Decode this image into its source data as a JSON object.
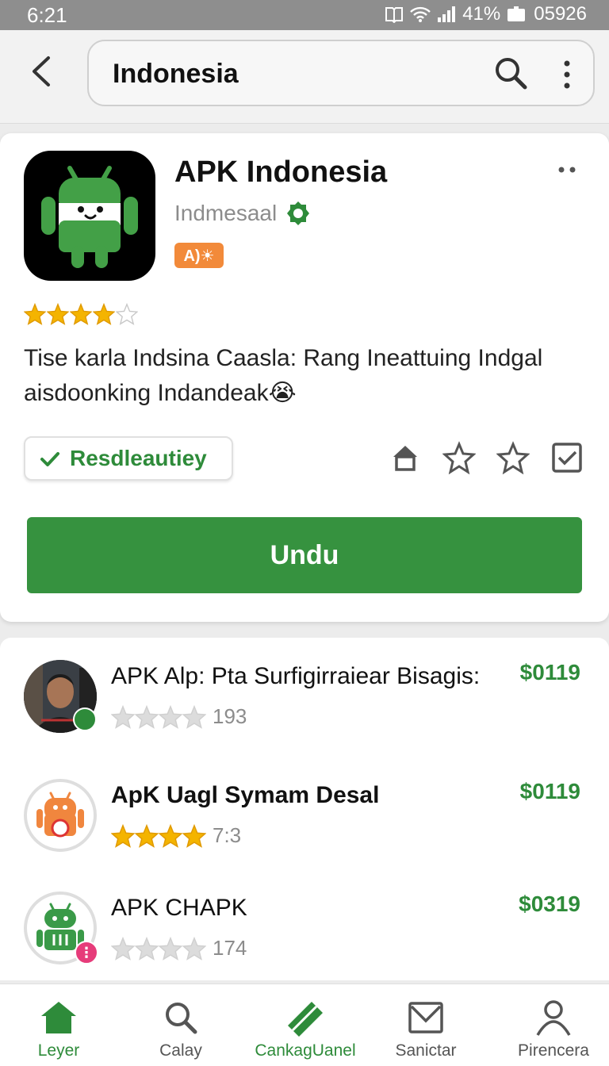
{
  "status_bar": {
    "time": "6:21",
    "battery": "41%",
    "extra": "05926"
  },
  "search": {
    "query": "Indonesia"
  },
  "app": {
    "title": "APK Indonesia",
    "developer": "Indmesaal",
    "badge": "A)☀",
    "rating": 4,
    "description": "Tise karla Indsina Caasla: Rang Ineattuing Indgal aisdoonking Indandeak😭",
    "verified_label": "Resdleautiey",
    "download_label": "Undu"
  },
  "list": [
    {
      "name": "APK Alp: Pta Surfigirraiear Bisagis:",
      "price": "$0119",
      "rating": 0,
      "count": "193"
    },
    {
      "name": "ApK Uagl Symam Desal",
      "price": "$0119",
      "rating": 4,
      "count": "7:3"
    },
    {
      "name": "APK CHAPK",
      "price": "$0319",
      "rating": 0,
      "count": "174"
    }
  ],
  "nav": [
    {
      "label": "Leyer",
      "icon": "home-icon",
      "active": true
    },
    {
      "label": "Calay",
      "icon": "search-icon",
      "active": false
    },
    {
      "label": "CankagUanel",
      "icon": "ticket-icon",
      "active": true
    },
    {
      "label": "Sanictar",
      "icon": "mail-icon",
      "active": false
    },
    {
      "label": "Pirencera",
      "icon": "profile-icon",
      "active": false
    }
  ],
  "colors": {
    "brand_green": "#36923f",
    "star_gold": "#f4b400",
    "badge_orange": "#f28a3a"
  }
}
